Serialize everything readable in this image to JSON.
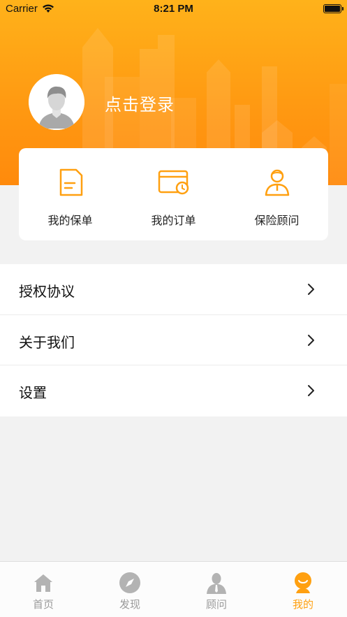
{
  "status_bar": {
    "carrier": "Carrier",
    "time": "8:21 PM"
  },
  "profile": {
    "login_text": "点击登录"
  },
  "quick_actions": [
    {
      "label": "我的保单",
      "icon": "policy-document-icon"
    },
    {
      "label": "我的订单",
      "icon": "order-card-icon"
    },
    {
      "label": "保险顾问",
      "icon": "advisor-person-icon"
    }
  ],
  "menu": [
    {
      "label": "授权协议"
    },
    {
      "label": "关于我们"
    },
    {
      "label": "设置"
    }
  ],
  "tab_bar": [
    {
      "label": "首页",
      "icon": "home-icon",
      "active": false
    },
    {
      "label": "发现",
      "icon": "compass-icon",
      "active": false
    },
    {
      "label": "顾问",
      "icon": "advisor-icon",
      "active": false
    },
    {
      "label": "我的",
      "icon": "my-profile-icon",
      "active": true
    }
  ],
  "colors": {
    "accent": "#ffa010",
    "header_top": "#ffb21a",
    "header_bottom": "#ff8a0c",
    "inactive_tab": "#9a9a9a"
  }
}
